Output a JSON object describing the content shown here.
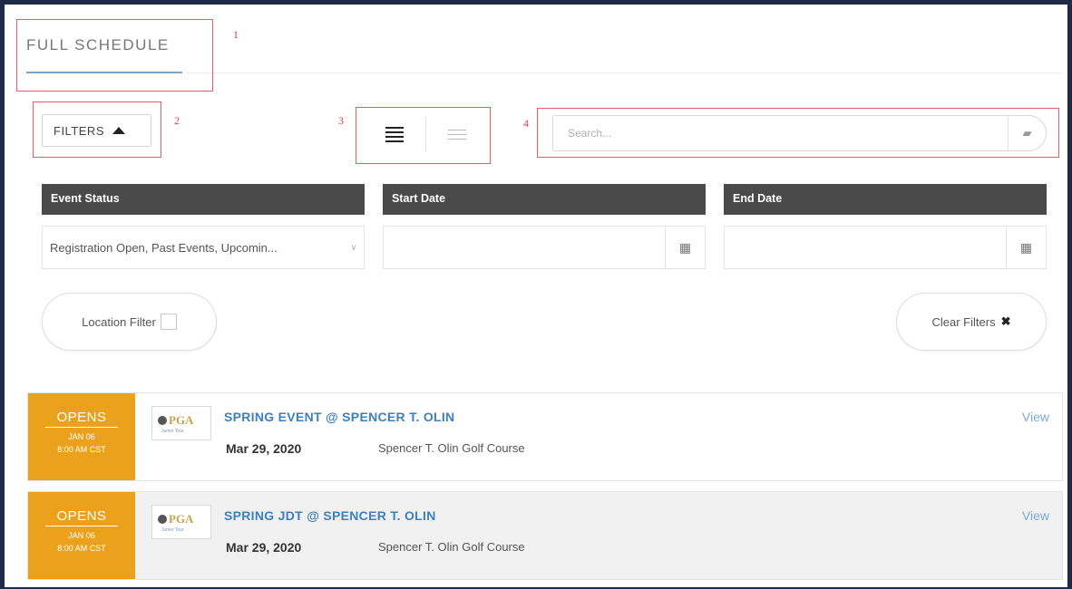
{
  "header": {
    "title": "FULL SCHEDULE"
  },
  "annotations": [
    "1",
    "2",
    "3",
    "4"
  ],
  "toolbar": {
    "filters_label": "FILTERS",
    "search_placeholder": "Search..."
  },
  "filters": {
    "event_status": {
      "label": "Event Status",
      "value": "Registration Open, Past Events, Upcomin..."
    },
    "start_date": {
      "label": "Start Date",
      "value": ""
    },
    "end_date": {
      "label": "End Date",
      "value": ""
    },
    "location_filter_label": "Location Filter",
    "clear_filters_label": "Clear Filters"
  },
  "events": [
    {
      "opens_label": "OPENS",
      "opens_date": "JAN 06",
      "opens_time": "8:00 AM CST",
      "title": "SPRING EVENT @ SPENCER T. OLIN",
      "date": "Mar 29, 2020",
      "location": "Spencer T. Olin Golf Course",
      "view_label": "View"
    },
    {
      "opens_label": "OPENS",
      "opens_date": "JAN 06",
      "opens_time": "8:00 AM CST",
      "title": "SPRING JDT @ SPENCER T. OLIN",
      "date": "Mar 29, 2020",
      "location": "Spencer T. Olin Golf Course",
      "view_label": "View"
    }
  ],
  "logo": {
    "name": "pga-logo",
    "text": "PGA",
    "sub": "Junior Tour"
  },
  "colors": {
    "accent": "#eba11b",
    "link": "#3d80c0",
    "header_bg": "#4a4a4a",
    "annotation": "#e35d68"
  }
}
